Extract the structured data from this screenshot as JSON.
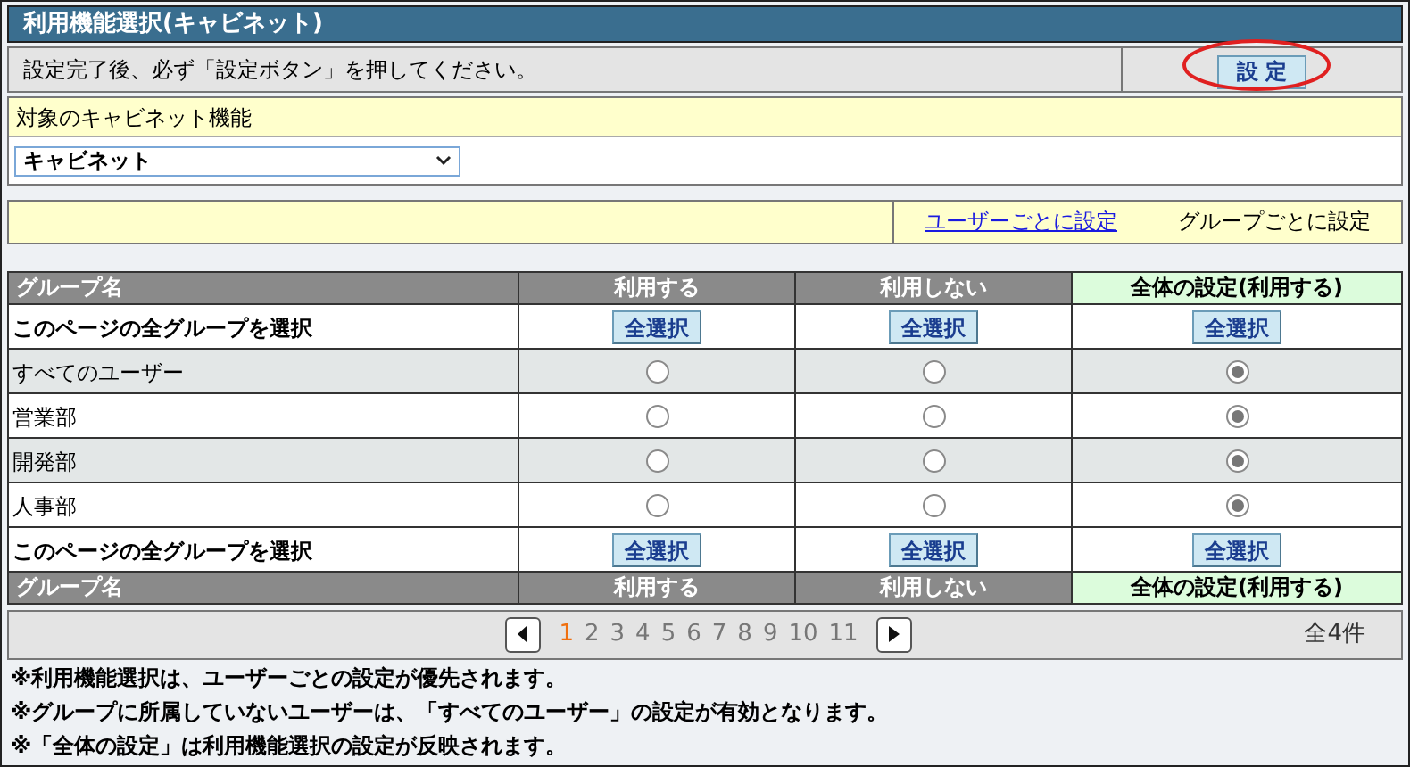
{
  "title": "利用機能選択(キャビネット)",
  "instruction": {
    "text": "設定完了後、必ず「設定ボタン」を押してください。",
    "button": "設 定",
    "highlighted": true
  },
  "target": {
    "label": "対象のキャビネット機能",
    "value": "キャビネット"
  },
  "modes": [
    {
      "label": "ユーザーごとに設定",
      "selected": false
    },
    {
      "label": "グループごとに設定",
      "selected": true
    }
  ],
  "table": {
    "header": [
      {
        "label": "グループ名",
        "kind": "name"
      },
      {
        "label": "利用する",
        "kind": "plain"
      },
      {
        "label": "利用しない",
        "kind": "plain"
      },
      {
        "label": "全体の設定(利用する)",
        "kind": "highlight"
      }
    ],
    "select_all_top": {
      "label": "このページの全グループを選択",
      "buttons": [
        "全選択",
        "全選択",
        "全選択"
      ]
    },
    "rows": [
      {
        "name": "すべてのユーザー",
        "options": [
          {
            "selected": false
          },
          {
            "selected": false
          },
          {
            "selected": true
          }
        ]
      },
      {
        "name": "営業部",
        "options": [
          {
            "selected": false
          },
          {
            "selected": false
          },
          {
            "selected": true
          }
        ]
      },
      {
        "name": "開発部",
        "options": [
          {
            "selected": false
          },
          {
            "selected": false
          },
          {
            "selected": true
          }
        ]
      },
      {
        "name": "人事部",
        "options": [
          {
            "selected": false
          },
          {
            "selected": false
          },
          {
            "selected": true
          }
        ]
      }
    ],
    "select_all_bottom": {
      "label": "このページの全グループを選択",
      "buttons": [
        "全選択",
        "全選択",
        "全選択"
      ]
    },
    "footer": [
      {
        "label": "グループ名",
        "kind": "name"
      },
      {
        "label": "利用する",
        "kind": "plain"
      },
      {
        "label": "利用しない",
        "kind": "plain"
      },
      {
        "label": "全体の設定(利用する)",
        "kind": "highlight"
      }
    ]
  },
  "pagination": {
    "pages": [
      {
        "label": "1",
        "selected": true
      },
      {
        "label": "2",
        "selected": false
      },
      {
        "label": "3",
        "selected": false
      },
      {
        "label": "4",
        "selected": false
      },
      {
        "label": "5",
        "selected": false
      },
      {
        "label": "6",
        "selected": false
      },
      {
        "label": "7",
        "selected": false
      },
      {
        "label": "8",
        "selected": false
      },
      {
        "label": "9",
        "selected": false
      },
      {
        "label": "10",
        "selected": false
      },
      {
        "label": "11",
        "selected": false
      }
    ],
    "total": "全4件"
  },
  "notes": [
    "※利用機能選択は、ユーザーごとの設定が優先されます。",
    "※グループに所属していないユーザーは、「すべてのユーザー」の設定が有効となります。",
    "※「全体の設定」は利用機能選択の設定が反映されます。"
  ]
}
